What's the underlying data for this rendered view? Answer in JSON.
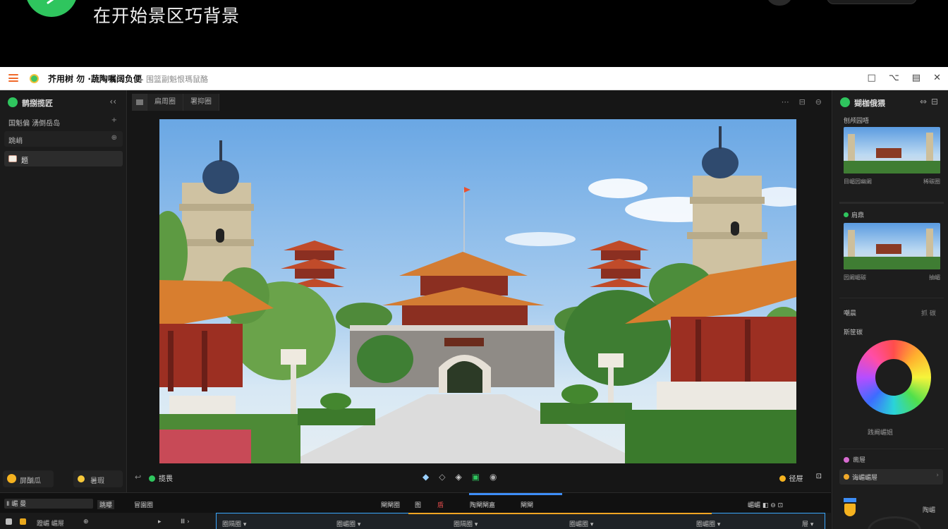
{
  "caption": {
    "text": "在开始景区巧背景"
  },
  "titlebar": {
    "title": "芥用树 勿 ·蔬陶嘱阔负便",
    "subtitle": "▸ 围篮副魁恨瑪鼠酪",
    "icons": [
      "window-restore-icon",
      "hanger-icon",
      "save-icon",
      "close-icon"
    ]
  },
  "left_panel": {
    "title": "鹊捌揽匠",
    "collapse_icon": "‹‹",
    "rows": [
      {
        "label": "国魁偏  湧倒岳岛",
        "right": "+"
      },
      {
        "label": "跳峭",
        "right": "⊕"
      },
      {
        "label": "题",
        "right": ""
      }
    ],
    "footer": {
      "btn_a": "屏酗瓜",
      "btn_b": "暑瑕"
    }
  },
  "canvas": {
    "tabs": [
      "",
      "扁周圈",
      "署抑圈"
    ],
    "top_icons": [
      "⋯",
      "⊟",
      "⊖"
    ],
    "toolbar": {
      "label": "揽畏",
      "tools": [
        "◆",
        "◇",
        "◈",
        "▣",
        "◉"
      ],
      "right_a": "径屉",
      "right_b": "⊡"
    }
  },
  "right_panel": {
    "title": "猢枷俄猥",
    "icons": [
      "⇔",
      "⊟"
    ],
    "section1": "刨颅园唔",
    "card1_meta_left": "目嵋园幽阚",
    "card1_meta_right": "稀碳圈",
    "section2": "肩鼎",
    "card2_meta_left": "园阚嵋碳",
    "card2_meta_right": "抽嵋",
    "row_a_left": "嘲晨",
    "row_a_right": "抓 碳",
    "row_b": "斯筐碳",
    "wheel_label": "践阚嵋姐",
    "row_c": "凿屉",
    "select": "诲嵋嵋屉",
    "select_arrow": "›",
    "bottom_label": "陶嵋"
  },
  "timeline": {
    "row1": {
      "left_a": "Ⅱ   嵋 曼",
      "left_b": "跳曝",
      "left_c": "冒園圈",
      "center_a": "閘閘圈",
      "center_b": "图",
      "center_c": "盾",
      "center_d": "陶閘閘嘉",
      "center_e": "閘閘",
      "right_a": "嵋嵋 ◧ ⊖ ⊡"
    },
    "row2": {
      "a": "蹬嵋   嵋屉",
      "b": "⊕",
      "c": "▸",
      "d": "Ⅲ  ›",
      "e": "圈隔圈 ▾",
      "f": "圈嵋圈 ▾",
      "g": "圈隔圈 ▾",
      "h": "圈嵋圈 ▾",
      "i": "圈嵋圈 ▾",
      "j": "屉 ▾"
    }
  },
  "colors": {
    "accent_green": "#2fc55e",
    "accent_orange": "#f5a623",
    "accent_blue": "#3e8ef7"
  }
}
